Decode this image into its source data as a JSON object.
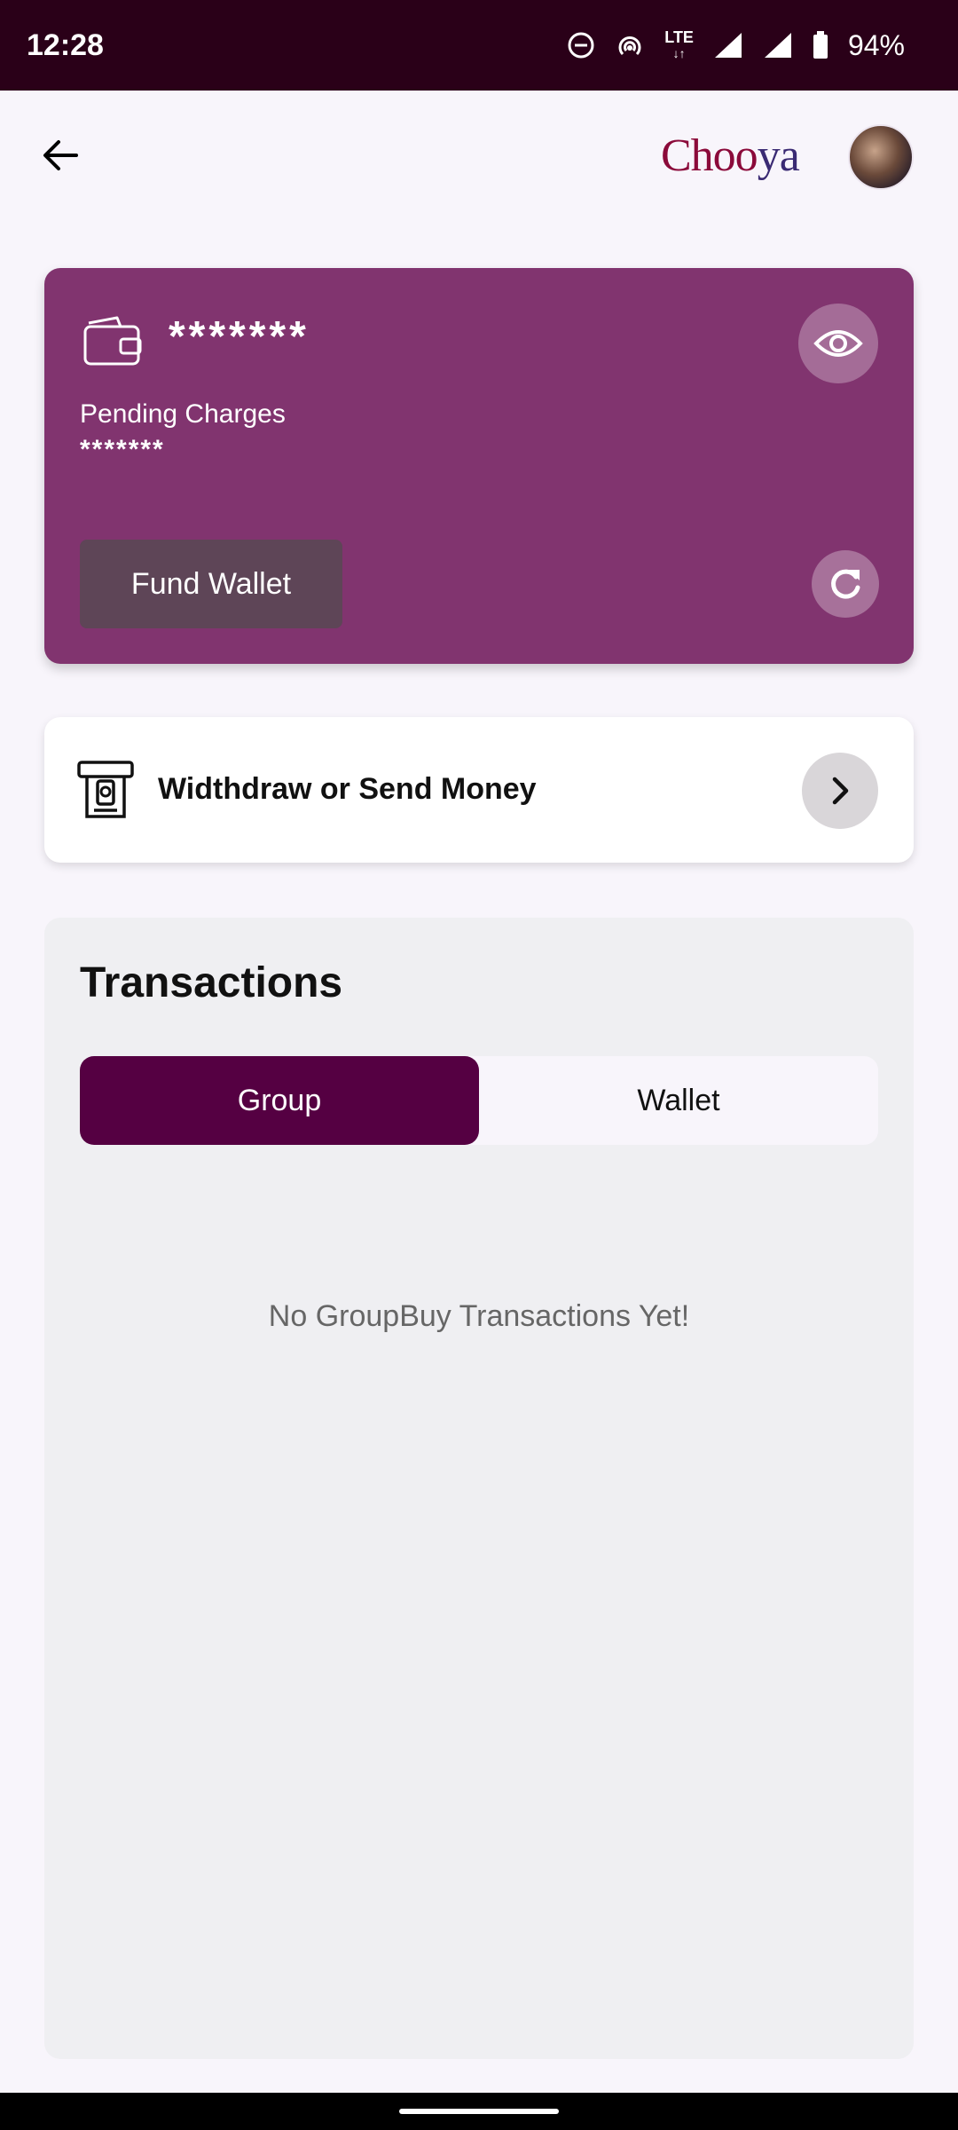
{
  "status_bar": {
    "time": "12:28",
    "network": "LTE",
    "battery": "94%"
  },
  "app": {
    "logo_main": "Choo",
    "logo_accent": "ya"
  },
  "wallet": {
    "balance": "*******",
    "pending_label": "Pending Charges",
    "pending_value": "*******",
    "fund_button": "Fund Wallet"
  },
  "withdraw": {
    "label": "Widthdraw or Send Money"
  },
  "transactions": {
    "title": "Transactions",
    "tabs": [
      {
        "label": "Group",
        "active": true
      },
      {
        "label": "Wallet",
        "active": false
      }
    ],
    "empty_message": "No GroupBuy Transactions Yet!"
  },
  "colors": {
    "card": "#81346f",
    "primary": "#550042",
    "status_bar": "#2a0018"
  }
}
